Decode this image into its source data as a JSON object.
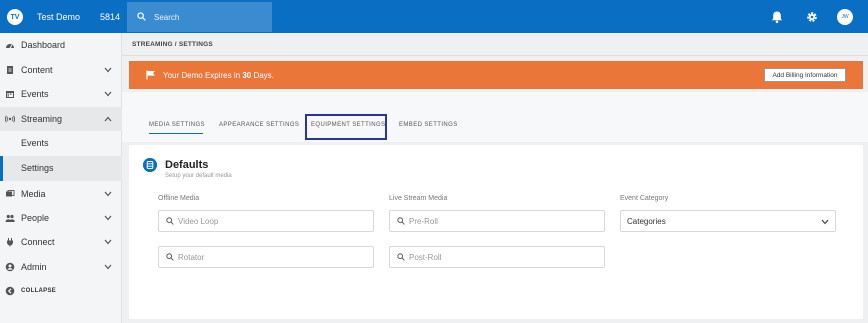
{
  "topbar": {
    "logo_text": "TV",
    "org_name": "Test Demo",
    "org_id": "5814",
    "search_placeholder": "Search",
    "avatar_initials": "JW",
    "colors": {
      "primary": "#0a6fc2"
    }
  },
  "sidebar": {
    "items": [
      {
        "label": "Dashboard",
        "icon": "dashboard-icon"
      },
      {
        "label": "Content",
        "icon": "document-icon"
      },
      {
        "label": "Events",
        "icon": "calendar-icon"
      },
      {
        "label": "Streaming",
        "icon": "broadcast-icon"
      },
      {
        "label": "Media",
        "icon": "media-icon"
      },
      {
        "label": "People",
        "icon": "people-icon"
      },
      {
        "label": "Connect",
        "icon": "plug-icon"
      },
      {
        "label": "Admin",
        "icon": "user-circle-icon"
      }
    ],
    "streaming_sub": [
      {
        "label": "Events"
      },
      {
        "label": "Settings"
      }
    ],
    "collapse_label": "COLLAPSE"
  },
  "breadcrumb": "STREAMING / SETTINGS",
  "banner": {
    "text_prefix": "Your Demo Expires in",
    "days": "30",
    "text_suffix": "Days.",
    "button_label": "Add Billing Information",
    "color": "#ea763a"
  },
  "tabs": [
    {
      "label": "MEDIA SETTINGS"
    },
    {
      "label": "APPEARANCE SETTINGS"
    },
    {
      "label": "EQUIPMENT SETTINGS"
    },
    {
      "label": "EMBED SETTINGS"
    }
  ],
  "defaults": {
    "title": "Defaults",
    "subtitle": "Setup your default media",
    "offline_label": "Offline Media",
    "live_label": "Live Stream Media",
    "category_label": "Event Category",
    "video_loop_placeholder": "Video Loop",
    "rotator_placeholder": "Rotator",
    "pre_roll_placeholder": "Pre-Roll",
    "post_roll_placeholder": "Post-Roll",
    "category_value": "Categories"
  }
}
